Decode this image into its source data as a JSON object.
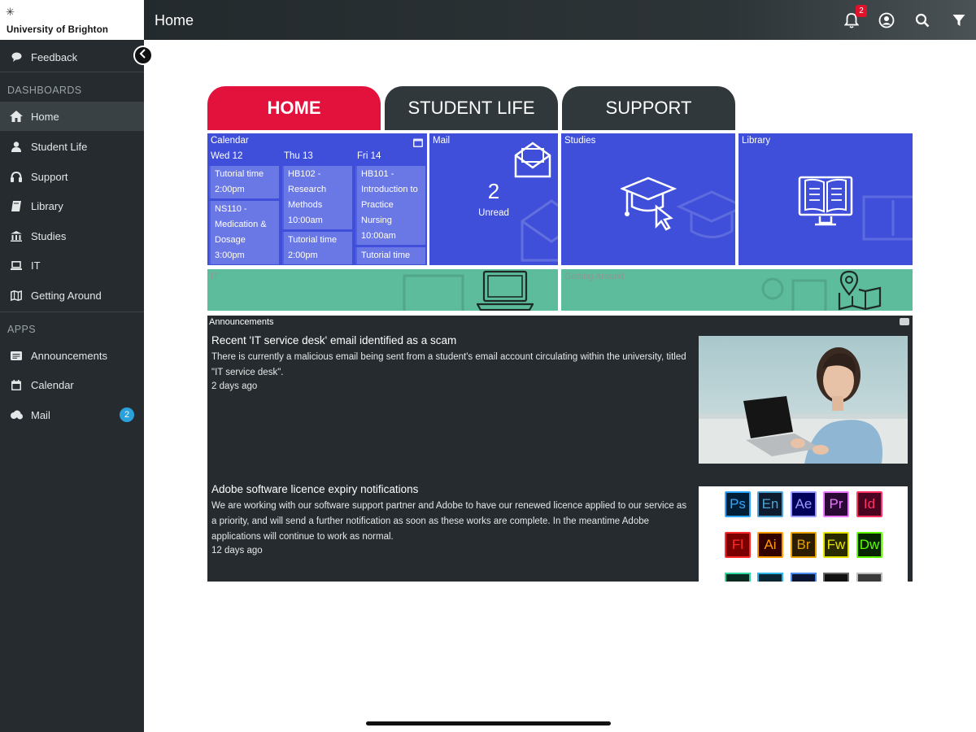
{
  "logo": {
    "mark": "✳",
    "name": "University of Brighton"
  },
  "topbar": {
    "title": "Home",
    "notification_count": "2"
  },
  "sidebar": {
    "feedback": "Feedback",
    "dashboards_heading": "DASHBOARDS",
    "dashboards": [
      {
        "label": "Home",
        "icon": "home-icon"
      },
      {
        "label": "Student Life",
        "icon": "person-icon"
      },
      {
        "label": "Support",
        "icon": "headset-icon"
      },
      {
        "label": "Library",
        "icon": "book-icon"
      },
      {
        "label": "Studies",
        "icon": "building-icon"
      },
      {
        "label": "IT",
        "icon": "laptop-icon"
      },
      {
        "label": "Getting Around",
        "icon": "map-icon"
      }
    ],
    "apps_heading": "APPS",
    "apps": [
      {
        "label": "Announcements",
        "icon": "megaphone-icon"
      },
      {
        "label": "Calendar",
        "icon": "calendar-icon"
      },
      {
        "label": "Mail",
        "icon": "cloud-icon",
        "badge": "2"
      }
    ]
  },
  "tabs": [
    "HOME",
    "STUDENT LIFE",
    "SUPPORT"
  ],
  "tiles": {
    "calendar": {
      "title": "Calendar",
      "days": [
        {
          "day": "Wed 12",
          "events": [
            "Tutorial time 2:00pm",
            "NS110 - Medication & Dosage 3:00pm"
          ]
        },
        {
          "day": "Thu 13",
          "events": [
            "HB102 - Research Methods 10:00am",
            "Tutorial time 2:00pm"
          ]
        },
        {
          "day": "Fri 14",
          "events": [
            "HB101 - Introduction to Practice Nursing 10:00am",
            "Tutorial time"
          ]
        }
      ]
    },
    "mail": {
      "title": "Mail",
      "count": "2",
      "label": "Unread"
    },
    "studies": {
      "title": "Studies"
    },
    "library": {
      "title": "Library"
    },
    "it": {
      "title": "IT"
    },
    "getting_around": {
      "title": "Getting Around"
    }
  },
  "announcements": {
    "heading": "Announcements",
    "items": [
      {
        "title": "Recent 'IT service desk' email identified as a scam",
        "body": "There is currently a malicious email being sent from a student's email account circulating within the university, titled \"IT service desk\".",
        "time": "2 days ago"
      },
      {
        "title": "Adobe software licence expiry notifications",
        "body": "We are working with our software support partner and Adobe to have our renewed licence applied to our service as a priority, and will send a further notification as soon as these works are complete. In the meantime Adobe applications will continue to work as normal.",
        "time": "12 days ago"
      }
    ],
    "adobe_apps": [
      {
        "abbr": "Ps",
        "color": "#31a8ff",
        "bg": "#001e36"
      },
      {
        "abbr": "En",
        "color": "#4aa5d6",
        "bg": "#0e1b2e"
      },
      {
        "abbr": "Ae",
        "color": "#9999ff",
        "bg": "#00005b"
      },
      {
        "abbr": "Pr",
        "color": "#ea77ff",
        "bg": "#2a0a35"
      },
      {
        "abbr": "Id",
        "color": "#ff3366",
        "bg": "#49021f"
      },
      {
        "abbr": "Fl",
        "color": "#ff2a2a",
        "bg": "#7a0000"
      },
      {
        "abbr": "Ai",
        "color": "#ff9a00",
        "bg": "#330000"
      },
      {
        "abbr": "Br",
        "color": "#e8a100",
        "bg": "#2b1c00"
      },
      {
        "abbr": "Fw",
        "color": "#e4e300",
        "bg": "#2a2a00"
      },
      {
        "abbr": "Dw",
        "color": "#5dff00",
        "bg": "#072401"
      }
    ]
  },
  "colors": {
    "accent_red": "#e3123d",
    "tile_blue": "#3f4fd9",
    "tile_green": "#5cbc9c",
    "sidebar_bg": "#252b2e"
  }
}
